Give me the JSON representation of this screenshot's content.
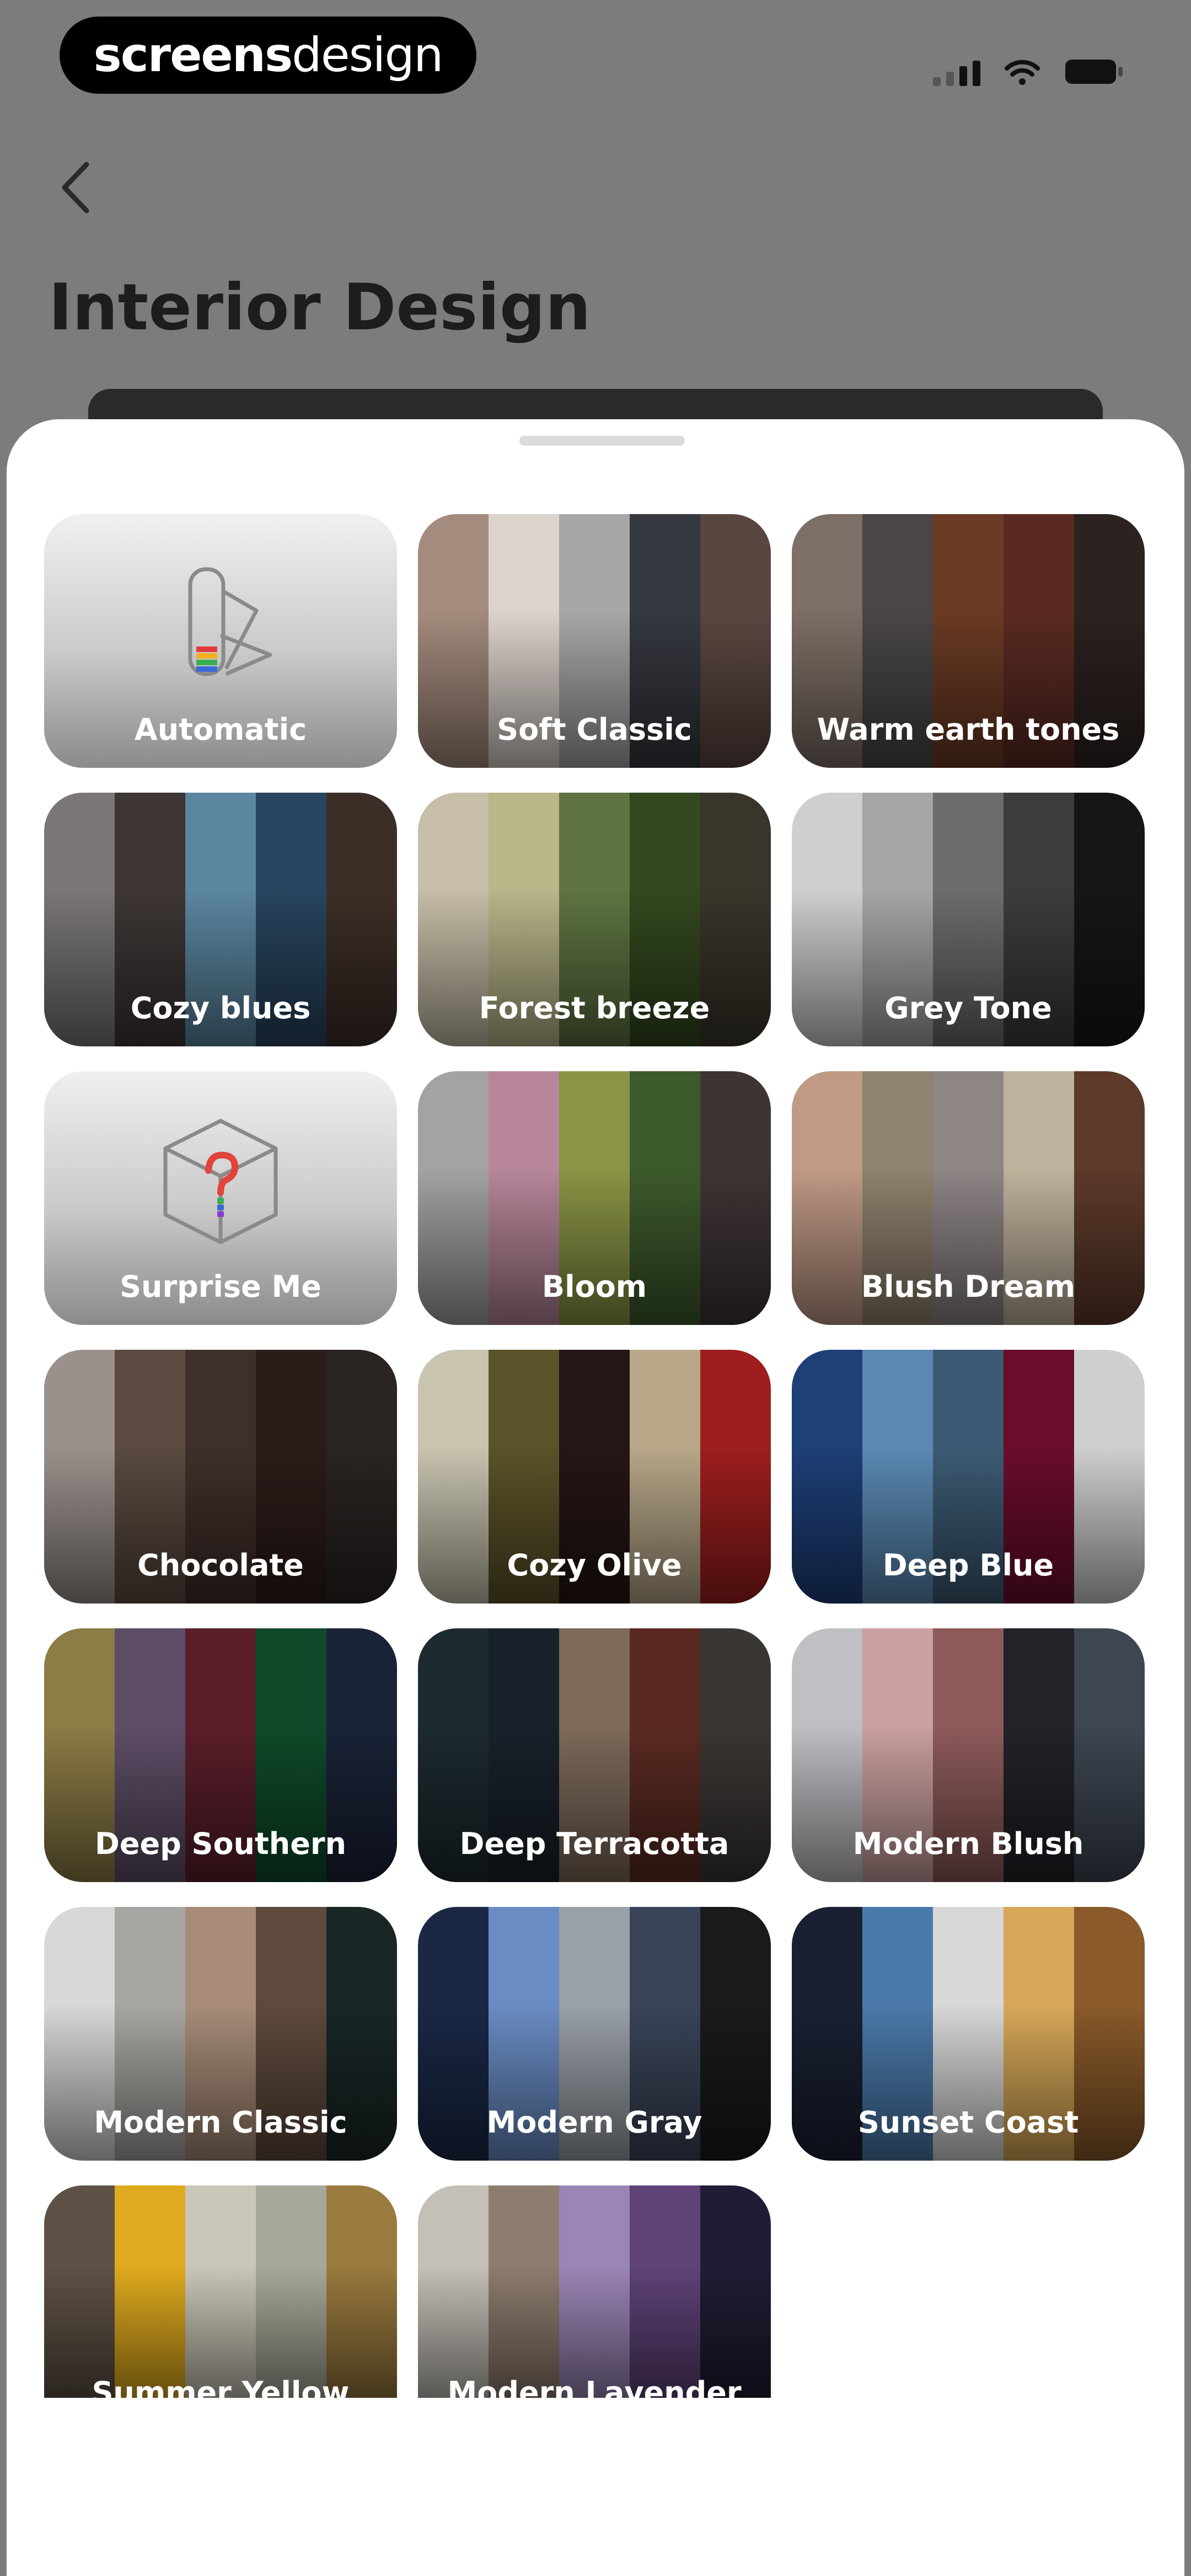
{
  "status_bar": {
    "brand_bold": "screens",
    "brand_light": "design"
  },
  "header": {
    "back_icon": "chevron-left-icon",
    "title": "Interior Design"
  },
  "palettes": [
    {
      "label": "Automatic",
      "kind": "icon",
      "icon": "palette-swatch-icon"
    },
    {
      "label": "Soft Classic",
      "colors": [
        "#a48b7d",
        "#dcd3cd",
        "#a9a7a5",
        "#35383f",
        "#5a4640"
      ]
    },
    {
      "label": "Warm earth tones",
      "colors": [
        "#7d6e66",
        "#4a4648",
        "#6b3a24",
        "#5a2a22",
        "#2c2220"
      ]
    },
    {
      "label": "Cozy blues",
      "colors": [
        "#7a7776",
        "#3d3635",
        "#5b86a0",
        "#28445e",
        "#3c2e27"
      ]
    },
    {
      "label": "Forest breeze",
      "colors": [
        "#c6bea8",
        "#b9b68a",
        "#5f7442",
        "#33481f",
        "#3a352b"
      ]
    },
    {
      "label": "Grey Tone",
      "colors": [
        "#cfcfcf",
        "#a6a6a6",
        "#6c6c6c",
        "#3c3c3c",
        "#161616"
      ]
    },
    {
      "label": "Surprise Me",
      "kind": "icon",
      "icon": "question-cube-icon"
    },
    {
      "label": "Bloom",
      "colors": [
        "#a3a3a3",
        "#b7869a",
        "#8b9445",
        "#3d5a2c",
        "#3e3434"
      ]
    },
    {
      "label": "Blush Dream",
      "colors": [
        "#c09a86",
        "#8f826e",
        "#8e8585",
        "#bfb39d",
        "#5d3a2a"
      ]
    },
    {
      "label": "Chocolate",
      "colors": [
        "#9a918c",
        "#5a4a40",
        "#3f2f2a",
        "#2b1c19",
        "#2a2422"
      ]
    },
    {
      "label": "Cozy Olive",
      "colors": [
        "#c9c4b0",
        "#5a5228",
        "#241614",
        "#b8a789",
        "#9e1e1e"
      ]
    },
    {
      "label": "Deep Blue",
      "colors": [
        "#1e3f78",
        "#5a89b3",
        "#3c5a73",
        "#6a0d2a",
        "#cfcfcf"
      ]
    },
    {
      "label": "Deep Southern",
      "colors": [
        "#8c7c46",
        "#5d4d66",
        "#5a1e2a",
        "#0e4a2a",
        "#1a2236"
      ]
    },
    {
      "label": "Deep Terracotta",
      "colors": [
        "#1d2a2f",
        "#18212a",
        "#7d6a5a",
        "#5a2a22",
        "#3a3634"
      ]
    },
    {
      "label": "Modern Blush",
      "colors": [
        "#bfbfc4",
        "#caa0a0",
        "#8e5a5a",
        "#222228",
        "#3e4652"
      ]
    },
    {
      "label": "Modern Classic",
      "colors": [
        "#d8d8d8",
        "#a8a6a2",
        "#a88c78",
        "#5e4a3c",
        "#1a2626"
      ]
    },
    {
      "label": "Modern Gray",
      "colors": [
        "#1a2846",
        "#6a8cc4",
        "#9aa0a8",
        "#3a4458",
        "#1a1a1c"
      ]
    },
    {
      "label": "Sunset Coast",
      "colors": [
        "#1a2032",
        "#4a7aaa",
        "#d8d8d8",
        "#d8a858",
        "#8a5a2a"
      ]
    },
    {
      "label": "Summer Yellow",
      "colors": [
        "#5e5246",
        "#e0aa1e",
        "#cac6b8",
        "#a8a89a",
        "#9a7a3e"
      ],
      "partial": true
    },
    {
      "label": "Modern Lavender",
      "colors": [
        "#c4c0b8",
        "#8e7c6e",
        "#9a86b6",
        "#5e4278",
        "#201c34"
      ],
      "partial": true
    }
  ]
}
